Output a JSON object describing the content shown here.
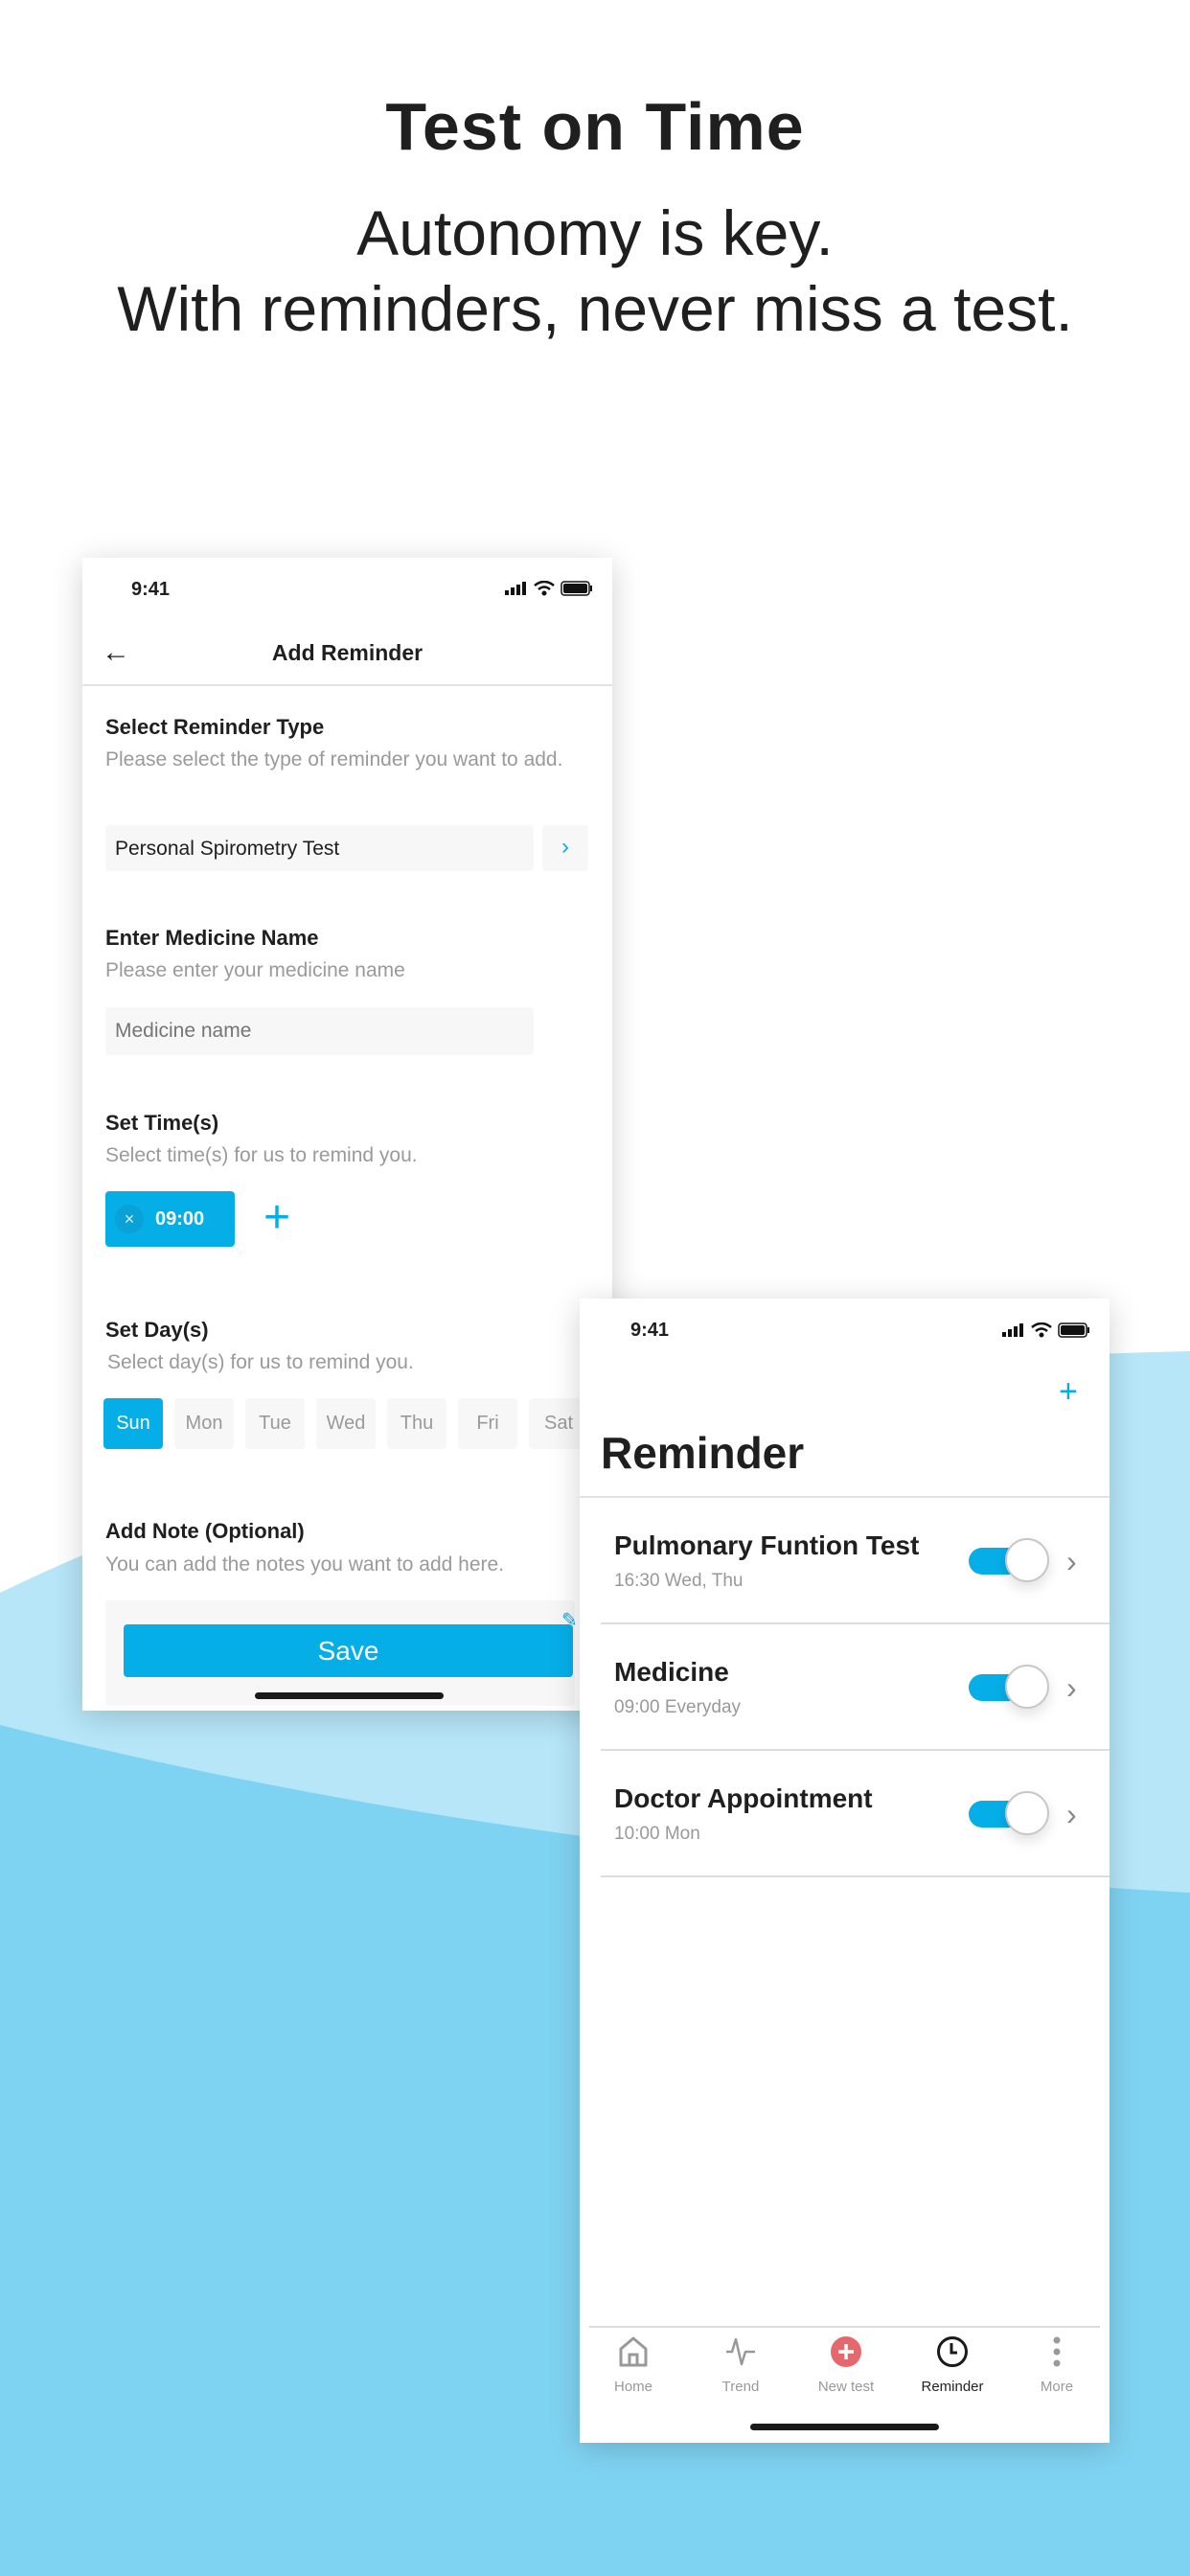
{
  "hero": {
    "title": "Test on Time",
    "subtitle_line1": "Autonomy is key.",
    "subtitle_line2": "With reminders, never miss a test."
  },
  "colors": {
    "accent": "#06aee8",
    "wave_light": "#b6e6f8",
    "wave_dark": "#7fd3f2",
    "new_test": "#e5686c"
  },
  "add_reminder": {
    "status_time": "9:41",
    "title": "Add Reminder",
    "type_label": "Select  Reminder Type",
    "type_desc": "Please select the type of reminder you want to add.",
    "type_value": "Personal Spirometry Test",
    "medicine_label": "Enter Medicine Name",
    "medicine_desc": "Please enter your medicine name",
    "medicine_placeholder": "Medicine name",
    "time_label": "Set Time(s)",
    "time_desc": "Select time(s) for us to remind you.",
    "times": [
      "09:00"
    ],
    "day_label": "Set Day(s)",
    "day_desc": "Select day(s) for us to remind you.",
    "days": [
      {
        "label": "Sun",
        "selected": true
      },
      {
        "label": "Mon",
        "selected": false
      },
      {
        "label": "Tue",
        "selected": false
      },
      {
        "label": "Wed",
        "selected": false
      },
      {
        "label": "Thu",
        "selected": false
      },
      {
        "label": "Fri",
        "selected": false
      },
      {
        "label": "Sat",
        "selected": false
      }
    ],
    "note_label": "Add Note (Optional)",
    "note_desc": "You can add the notes you want to add here.",
    "save_label": "Save"
  },
  "reminder_list": {
    "status_time": "9:41",
    "title": "Reminder",
    "items": [
      {
        "title": "Pulmonary Funtion Test",
        "subtitle": "16:30 Wed, Thu",
        "enabled": true
      },
      {
        "title": "Medicine",
        "subtitle": "09:00 Everyday",
        "enabled": true
      },
      {
        "title": "Doctor Appointment",
        "subtitle": "10:00 Mon",
        "enabled": true
      }
    ],
    "tabs": [
      {
        "label": "Home",
        "icon": "home-icon"
      },
      {
        "label": "Trend",
        "icon": "pulse-icon"
      },
      {
        "label": "New test",
        "icon": "plus-circle-icon"
      },
      {
        "label": "Reminder",
        "icon": "clock-icon",
        "active": true
      },
      {
        "label": "More",
        "icon": "more-vertical-icon"
      }
    ]
  }
}
